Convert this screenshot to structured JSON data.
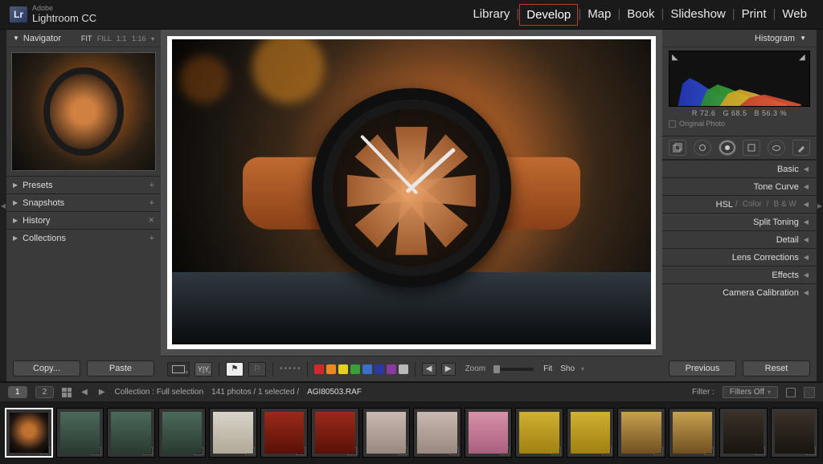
{
  "brand": {
    "small": "Adobe",
    "big": "Lightroom CC"
  },
  "modules": [
    "Library",
    "Develop",
    "Map",
    "Book",
    "Slideshow",
    "Print",
    "Web"
  ],
  "active_module": "Develop",
  "nav": {
    "title": "Navigator",
    "zoom_opts": [
      "FIT",
      "FILL",
      "1:1",
      "1:16"
    ],
    "accordion": [
      {
        "label": "Presets",
        "plus": true
      },
      {
        "label": "Snapshots",
        "plus": true
      },
      {
        "label": "History",
        "plus": false
      },
      {
        "label": "Collections",
        "plus": true
      }
    ],
    "copy": "Copy...",
    "paste": "Paste"
  },
  "toolbar": {
    "zoom_label": "Zoom",
    "fit": "Fit",
    "sho": "Sho",
    "swatches": [
      "#d02a2a",
      "#e88a20",
      "#e8d020",
      "#3aa03a",
      "#3a70c8",
      "#2a3aa0",
      "#8a3aa0",
      "#b8b8b8"
    ]
  },
  "right": {
    "histogram": "Histogram",
    "readout_r": "R",
    "readout_rv": "72.6",
    "readout_g": "G",
    "readout_gv": "68.5",
    "readout_b": "B",
    "readout_bv": "56.3",
    "readout_pct": "%",
    "orig": "Original Photo",
    "panels": [
      "Basic",
      "Tone Curve",
      "HSL",
      "Split Toning",
      "Detail",
      "Lens Corrections",
      "Effects",
      "Camera Calibration"
    ],
    "hsl_sub": [
      "Color",
      "B & W"
    ],
    "previous": "Previous",
    "reset": "Reset"
  },
  "info": {
    "pg1": "1",
    "pg2": "2",
    "collection": "Collection : Full selection",
    "count": "141 photos / 1 selected /",
    "file": "AGI80503.RAF",
    "filter_label": "Filter :",
    "filter_value": "Filters Off"
  }
}
